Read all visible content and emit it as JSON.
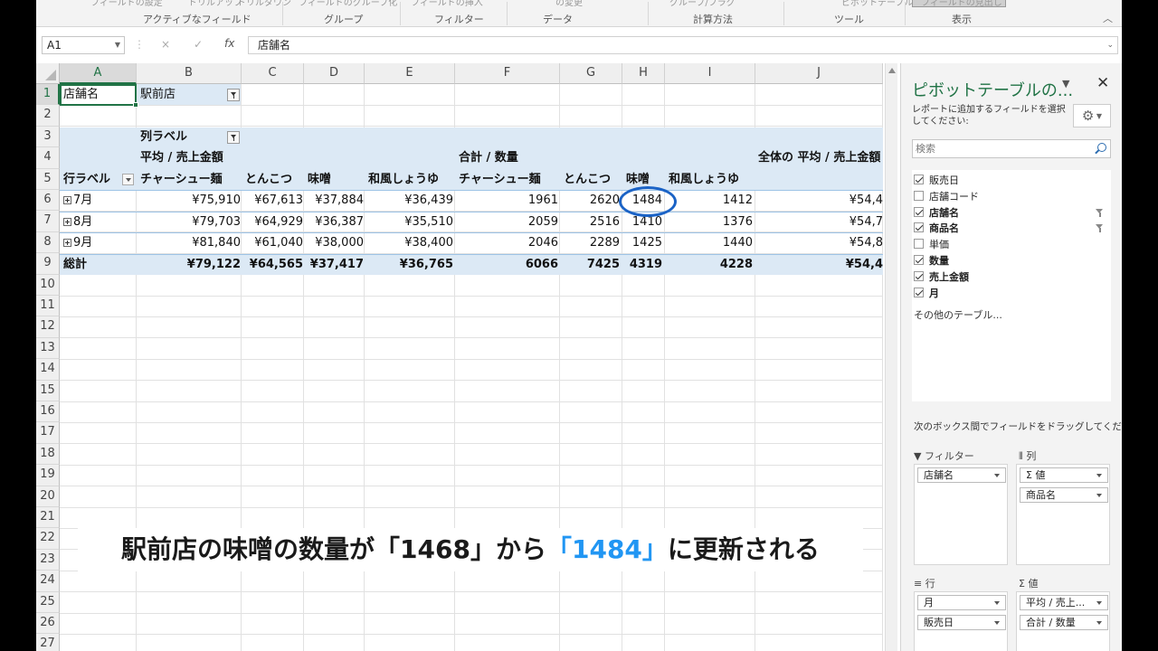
{
  "ribbon": {
    "top_fragments": [
      "フィールドの設定",
      "ドリルアップ",
      "ドリルダウン",
      "フィールドのグループ化",
      "フィールドの挿入",
      "の変更",
      "グループ/フラグ",
      "ピボットテーブル",
      "フィールドの見出し"
    ],
    "groups": [
      "アクティブなフィールド",
      "グループ",
      "フィルター",
      "データ",
      "計算方法",
      "ツール",
      "表示"
    ]
  },
  "formula_bar": {
    "name_box": "A1",
    "fx": "fx",
    "cancel": "×",
    "enter": "✓",
    "formula": "店舗名"
  },
  "sheet": {
    "columns": [
      "A",
      "B",
      "C",
      "D",
      "E",
      "F",
      "G",
      "H",
      "I",
      "J"
    ],
    "rows": [
      "1",
      "2",
      "3",
      "4",
      "5",
      "6",
      "7",
      "8",
      "9",
      "10",
      "11",
      "12",
      "13",
      "14",
      "15",
      "16",
      "17",
      "18",
      "19",
      "20",
      "21",
      "22",
      "23",
      "24",
      "25",
      "26",
      "27"
    ],
    "filter_label": "店舗名",
    "filter_value": "駅前店",
    "col_labels": "列ラベル",
    "avg_header": "平均 / 売上金額",
    "sum_header": "合計 / 数量",
    "grand_avg_header": "全体の 平均 / 売上金額",
    "row_labels": "行ラベル",
    "products": [
      "チャーシュー麺",
      "とんこつ",
      "味噌",
      "和風しょうゆ"
    ],
    "data_rows": [
      {
        "label": "7月",
        "avg": [
          "¥75,910",
          "¥67,613",
          "¥37,884",
          "¥36,439"
        ],
        "qty": [
          "1961",
          "2620",
          "1484",
          "1412"
        ],
        "grand": "¥54,4"
      },
      {
        "label": "8月",
        "avg": [
          "¥79,703",
          "¥64,929",
          "¥36,387",
          "¥35,510"
        ],
        "qty": [
          "2059",
          "2516",
          "1410",
          "1376"
        ],
        "grand": "¥54,7"
      },
      {
        "label": "9月",
        "avg": [
          "¥81,840",
          "¥61,040",
          "¥38,000",
          "¥38,400"
        ],
        "qty": [
          "2046",
          "2289",
          "1425",
          "1440"
        ],
        "grand": "¥54,8"
      }
    ],
    "total_row": {
      "label": "総計",
      "avg": [
        "¥79,122",
        "¥64,565",
        "¥37,417",
        "¥36,765"
      ],
      "qty": [
        "6066",
        "7425",
        "4319",
        "4228"
      ],
      "grand": "¥54,4"
    }
  },
  "caption": {
    "part1": "駅前店の味噌の数量が「1468」から",
    "highlight": "「1484」",
    "part2": "に更新される",
    "highlight_color": "#2196f3"
  },
  "pivot_pane": {
    "title": "ピボットテーブルの...",
    "instructions": "レポートに追加するフィールドを選択してください:",
    "search_placeholder": "検索",
    "fields": [
      {
        "label": "販売日",
        "checked": true,
        "bold": false,
        "filtered": false
      },
      {
        "label": "店舗コード",
        "checked": false,
        "bold": false,
        "filtered": false
      },
      {
        "label": "店舗名",
        "checked": true,
        "bold": true,
        "filtered": true
      },
      {
        "label": "商品名",
        "checked": true,
        "bold": true,
        "filtered": true
      },
      {
        "label": "単価",
        "checked": false,
        "bold": false,
        "filtered": false
      },
      {
        "label": "数量",
        "checked": true,
        "bold": true,
        "filtered": false
      },
      {
        "label": "売上金額",
        "checked": true,
        "bold": true,
        "filtered": false
      },
      {
        "label": "月",
        "checked": true,
        "bold": true,
        "filtered": false
      }
    ],
    "more_tables": "その他のテーブル...",
    "drag_instructions": "次のボックス間でフィールドをドラッグしてください:",
    "areas": {
      "filters": {
        "title": "フィルター",
        "items": [
          "店舗名"
        ]
      },
      "columns": {
        "title": "列",
        "items": [
          "Σ 値",
          "商品名"
        ]
      },
      "rows": {
        "title": "行",
        "items": [
          "月",
          "販売日"
        ]
      },
      "values": {
        "title": "Σ 値",
        "items": [
          "平均 / 売上...",
          "合計 / 数量"
        ]
      }
    }
  },
  "colors": {
    "excel_green": "#217346",
    "pivot_band": "#dce9f5",
    "annotation_circle": "#1b63c6"
  }
}
